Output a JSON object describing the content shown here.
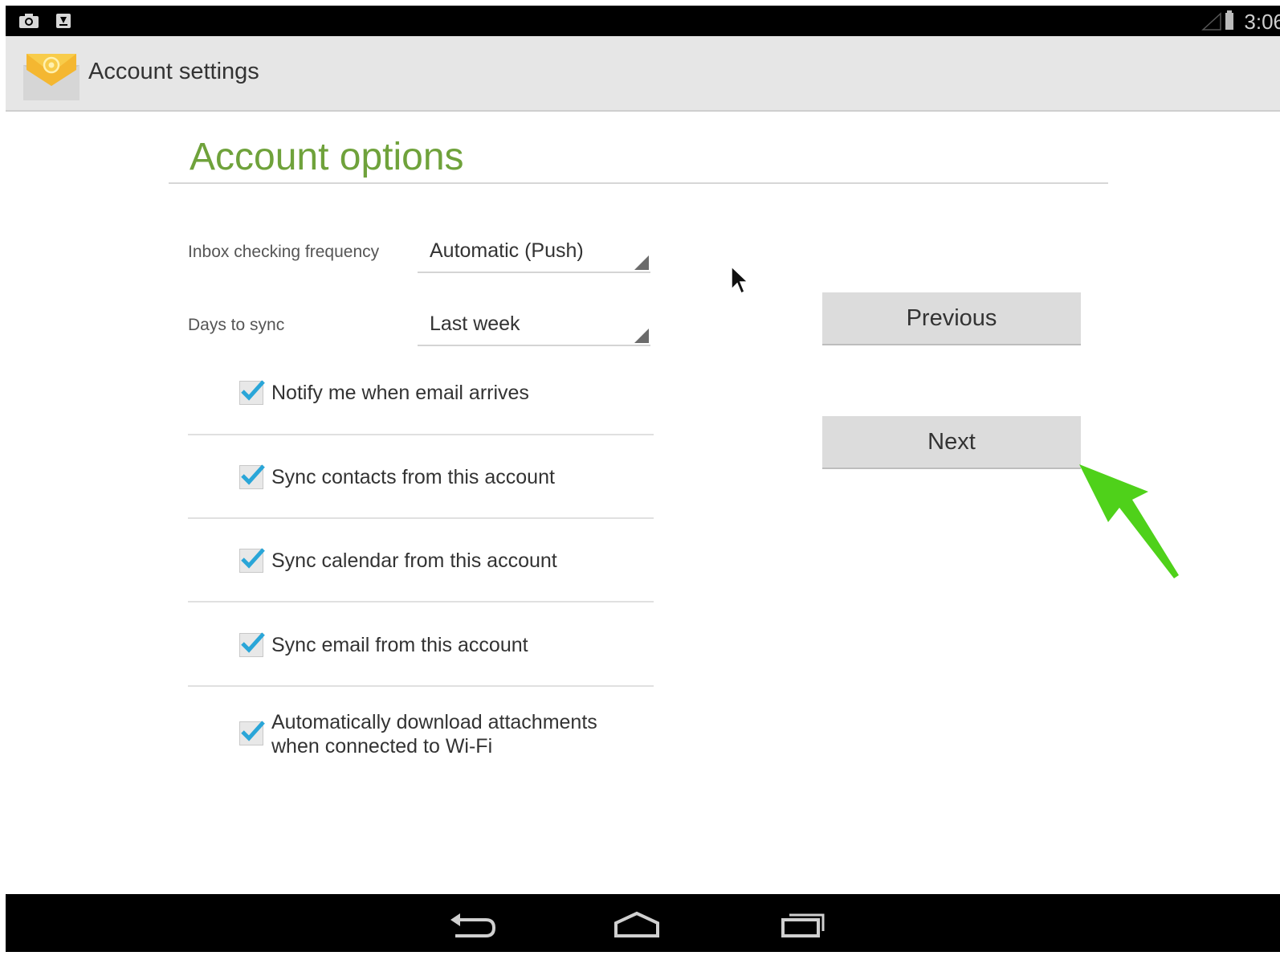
{
  "status_bar": {
    "time": "3:06",
    "icons": [
      "screenshot-icon",
      "download-icon",
      "signal-icon",
      "battery-icon"
    ]
  },
  "action_bar": {
    "title": "Account settings",
    "icon": "email-app-icon"
  },
  "main": {
    "section_title": "Account options",
    "fields": [
      {
        "label": "Inbox checking frequency",
        "value": "Automatic (Push)"
      },
      {
        "label": "Days to sync",
        "value": "Last week"
      }
    ],
    "checkboxes": [
      {
        "label": "Notify me when email arrives",
        "checked": true
      },
      {
        "label": "Sync contacts from this account",
        "checked": true
      },
      {
        "label": "Sync calendar from this account",
        "checked": true
      },
      {
        "label": "Sync email from this account",
        "checked": true
      },
      {
        "label_line1": "Automatically download attachments",
        "label_line2": "when connected to Wi-Fi",
        "checked": true
      }
    ]
  },
  "buttons": {
    "previous": "Previous",
    "next": "Next"
  },
  "annotation": {
    "arrow_color": "#4fd11a",
    "points_to": "Next"
  },
  "nav_bar": {
    "icons": [
      "back-icon",
      "home-icon",
      "recents-icon"
    ]
  },
  "colors": {
    "accent": "#6fa23b",
    "check": "#2aa6d8"
  }
}
